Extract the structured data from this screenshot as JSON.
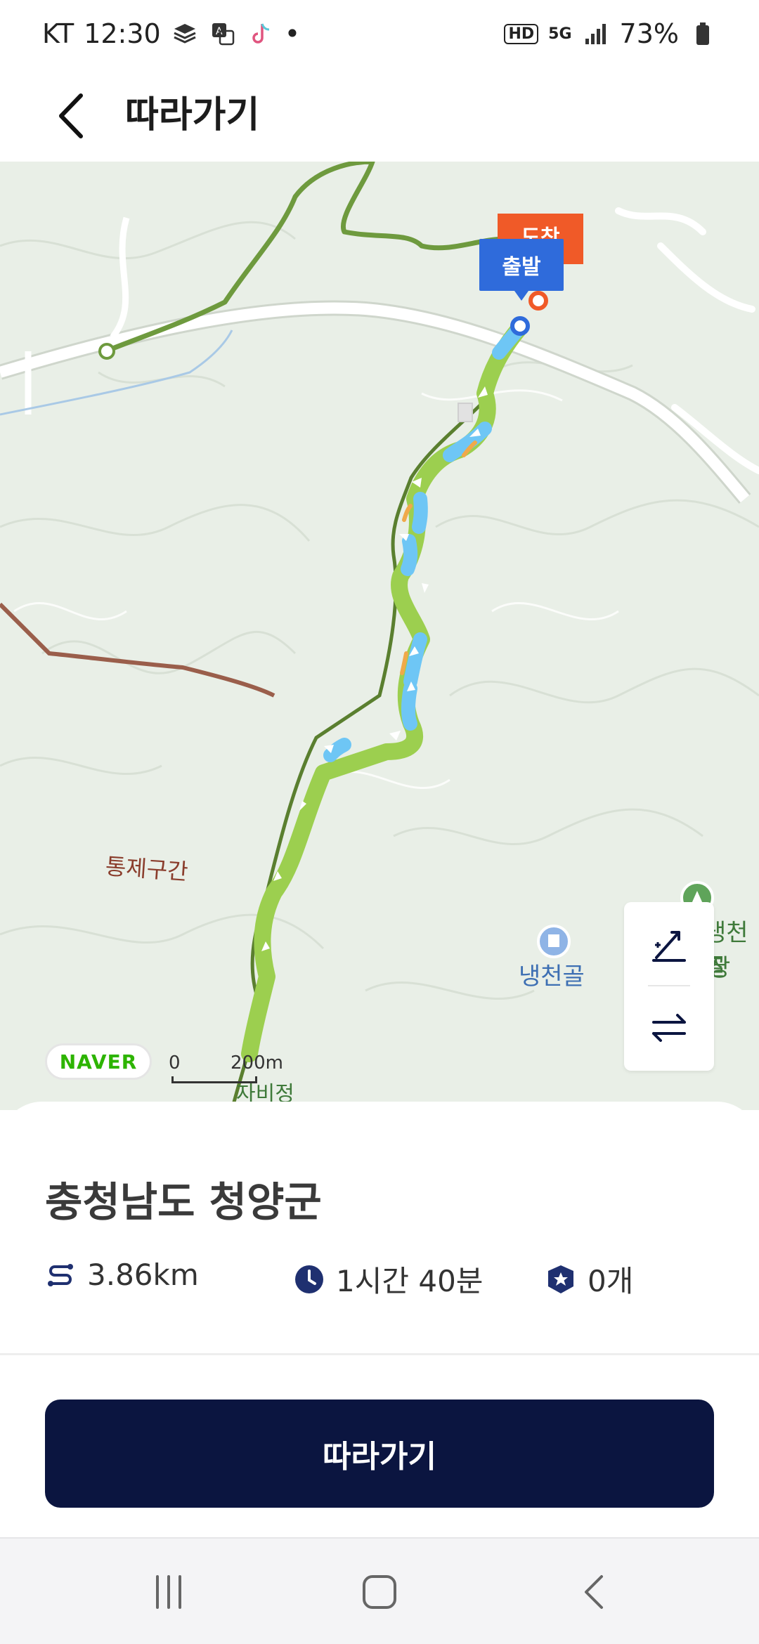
{
  "status_bar": {
    "carrier": "KT",
    "time": "12:30",
    "dot": "•",
    "hd": "HD",
    "network": "5G",
    "battery": "73%",
    "icons": [
      "layers-icon",
      "translate-icon",
      "tiktok-icon",
      "signal-icon",
      "battery-icon"
    ]
  },
  "header": {
    "title": "따라가기",
    "back_icon": "chevron-left-icon"
  },
  "map": {
    "pins": {
      "arrive": "도착",
      "start": "출발"
    },
    "labels": {
      "control_section": "통제구간",
      "naengcheongol": "냉천골",
      "partial_right_1": "냉천골",
      "partial_right_2": "장",
      "bottom_partial": "자비정"
    },
    "logo": "NAVER",
    "scale": {
      "zero": "0",
      "distance": "200m"
    },
    "controls": [
      "elevation-icon",
      "swap-direction-icon"
    ],
    "colors": {
      "route_green": "#9ccf4f",
      "route_blue": "#6ec6f5",
      "trail_dark_green": "#6e9a3e",
      "road": "#ffffff",
      "control_line": "#9a5e4b"
    }
  },
  "sheet": {
    "region": "충청남도 청양군",
    "distance": "3.86km",
    "duration": "1시간 40분",
    "stamps": "0개",
    "follow_button": "따라가기"
  },
  "navbar": {
    "items": [
      "recent-apps-icon",
      "home-icon",
      "back-icon"
    ]
  }
}
